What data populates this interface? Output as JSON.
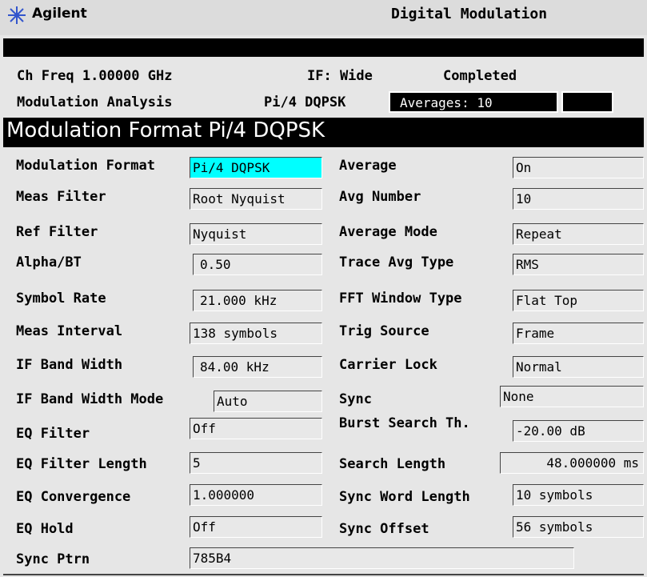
{
  "header": {
    "brand": "Agilent",
    "mode": "Digital Modulation"
  },
  "status": {
    "ch_freq": "Ch Freq 1.00000 GHz",
    "if_width": "IF: Wide",
    "state": "Completed",
    "measurement": "Modulation Analysis",
    "format": "Pi/4 DQPSK",
    "averages": "Averages: 10"
  },
  "menu": {
    "title": "Modulation Format Pi/4 DQPSK"
  },
  "left": [
    {
      "label": "Modulation Format",
      "value": "Pi/4 DQPSK"
    },
    {
      "label": "Meas Filter",
      "value": "Root Nyquist"
    },
    {
      "label": "Ref Filter",
      "value": "Nyquist"
    },
    {
      "label": "Alpha/BT",
      "value": "0.50"
    },
    {
      "label": "Symbol Rate",
      "value": "21.000 kHz"
    },
    {
      "label": "Meas Interval",
      "value": "138 symbols"
    },
    {
      "label": "IF Band Width",
      "value": "84.00 kHz"
    },
    {
      "label": "IF Band Width Mode",
      "value": "Auto"
    },
    {
      "label": "EQ Filter",
      "value": "Off"
    },
    {
      "label": "EQ Filter Length",
      "value": "5"
    },
    {
      "label": "EQ Convergence",
      "value": "1.000000"
    },
    {
      "label": "EQ Hold",
      "value": "Off"
    },
    {
      "label": "Sync Ptrn",
      "value": "785B4"
    }
  ],
  "right": [
    {
      "label": "Average",
      "value": "On"
    },
    {
      "label": "Avg Number",
      "value": "10"
    },
    {
      "label": "Average Mode",
      "value": "Repeat"
    },
    {
      "label": "Trace Avg Type",
      "value": "RMS"
    },
    {
      "label": "FFT Window Type",
      "value": "Flat Top"
    },
    {
      "label": "Trig Source",
      "value": "Frame"
    },
    {
      "label": "Carrier Lock",
      "value": "Normal"
    },
    {
      "label": "Sync",
      "value": "None"
    },
    {
      "label": "Burst Search Th.",
      "value": "-20.00 dB"
    },
    {
      "label": "Search Length",
      "value": "48.000000 ms"
    },
    {
      "label": "Sync Word Length",
      "value": "10 symbols"
    },
    {
      "label": "Sync Offset",
      "value": "56 symbols"
    }
  ]
}
